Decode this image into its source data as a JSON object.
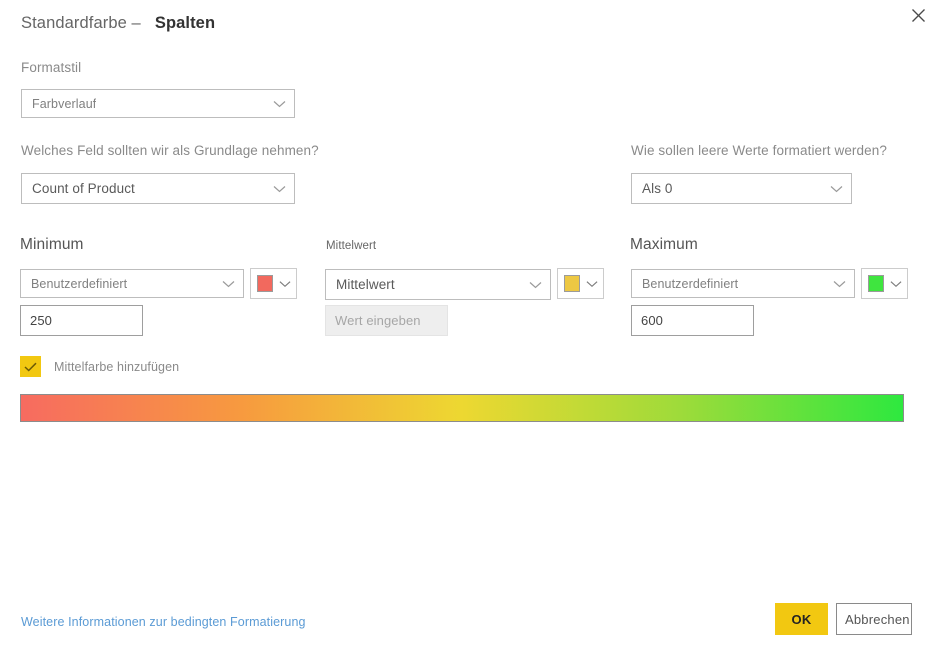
{
  "window": {
    "close_icon": "close-icon"
  },
  "header": {
    "prefix": "Standardfarbe –",
    "title": "Spalten"
  },
  "format_style": {
    "label": "Formatstil",
    "value": "Farbverlauf"
  },
  "base_field": {
    "label": "Welches Feld sollten wir als Grundlage nehmen?",
    "value": "Count of Product"
  },
  "blank_values": {
    "label": "Wie sollen leere Werte formatiert werden?",
    "value": "Als 0"
  },
  "minimum": {
    "label": "Minimum",
    "mode": "Benutzerdefiniert",
    "value": "250",
    "color": "#F2695E",
    "color_name": "color-swatch-red"
  },
  "middle": {
    "label": "Mittelwert",
    "mode": "Mittelwert",
    "value": "",
    "placeholder": "Wert eingeben",
    "color": "#EDC843",
    "color_name": "color-swatch-yellow"
  },
  "maximum": {
    "label": "Maximum",
    "mode": "Benutzerdefiniert",
    "value": "600",
    "color": "#3FE53F",
    "color_name": "color-swatch-green"
  },
  "middle_color_checkbox": {
    "label": "Mittelfarbe hinzufügen",
    "checked": true,
    "accent": "#F2C811"
  },
  "gradient_preview": {
    "stops": [
      "#F76B60",
      "#F79A3F",
      "#EDD831",
      "#9DDB3A",
      "#2EE83F"
    ]
  },
  "footer": {
    "link": "Weitere Informationen zur bedingten Formatierung",
    "link_color": "#5B9BD5",
    "ok_label": "OK",
    "cancel_label": "Abbrechen"
  }
}
